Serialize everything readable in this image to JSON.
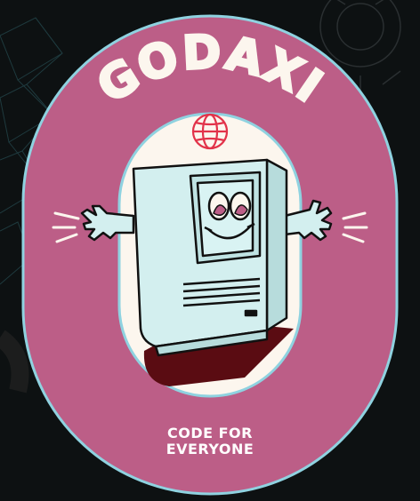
{
  "brand": {
    "name": "GODAXI",
    "slogan_line1": "CODE FOR",
    "slogan_line2": "EVERYONE"
  },
  "colors": {
    "badge_fill": "#bc5e87",
    "badge_outline": "#8fd2e0",
    "inner_fill": "#fcf6ee",
    "computer_body": "#d3efef",
    "shadow": "#5a0c12",
    "globe": "#e2334a",
    "background": "#0d1112"
  },
  "icons": {
    "globe": "globe-icon",
    "character": "retro-computer-mascot"
  }
}
